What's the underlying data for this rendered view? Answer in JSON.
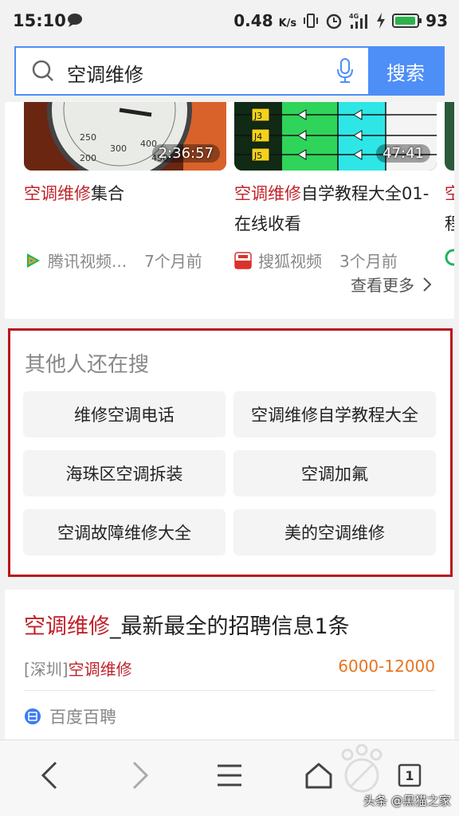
{
  "status_bar": {
    "time": "15:10",
    "speed": "0.48",
    "speed_unit": "K/s",
    "network": "4G",
    "battery": "93"
  },
  "search": {
    "query": "空调维修",
    "button_label": "搜索"
  },
  "videos": [
    {
      "duration": "2:36:57",
      "title_highlight": "空调维修",
      "title_rest": "集合",
      "source": "腾讯视频...",
      "age": "7个月前"
    },
    {
      "duration": "47:41",
      "title_highlight": "空调维修",
      "title_rest": "自学教程大全01-在线收看",
      "source": "搜狐视频",
      "age": "3个月前",
      "thumb_labels": [
        "J3",
        "J4",
        "J5"
      ]
    },
    {
      "title_highlight": "空",
      "title_rest": "程"
    }
  ],
  "see_more": "查看更多",
  "related": {
    "title": "其他人还在搜",
    "items": [
      "维修空调电话",
      "空调维修自学教程大全",
      "海珠区空调拆装",
      "空调加氟",
      "空调故障维修大全",
      "美的空调维修"
    ]
  },
  "job": {
    "title_highlight": "空调维修",
    "title_rest": "_最新最全的招聘信息1条",
    "location": "[深圳]",
    "location_highlight": "空调维修",
    "salary": "6000-12000",
    "source": "百度百聘"
  },
  "bottom_nav": {
    "tab_count": "1"
  },
  "watermark": "头条 @黑猫之家",
  "colors": {
    "accent": "#4e8ef7",
    "highlight": "#c0222a",
    "salary": "#e8741f",
    "related_border": "#b7161e"
  }
}
